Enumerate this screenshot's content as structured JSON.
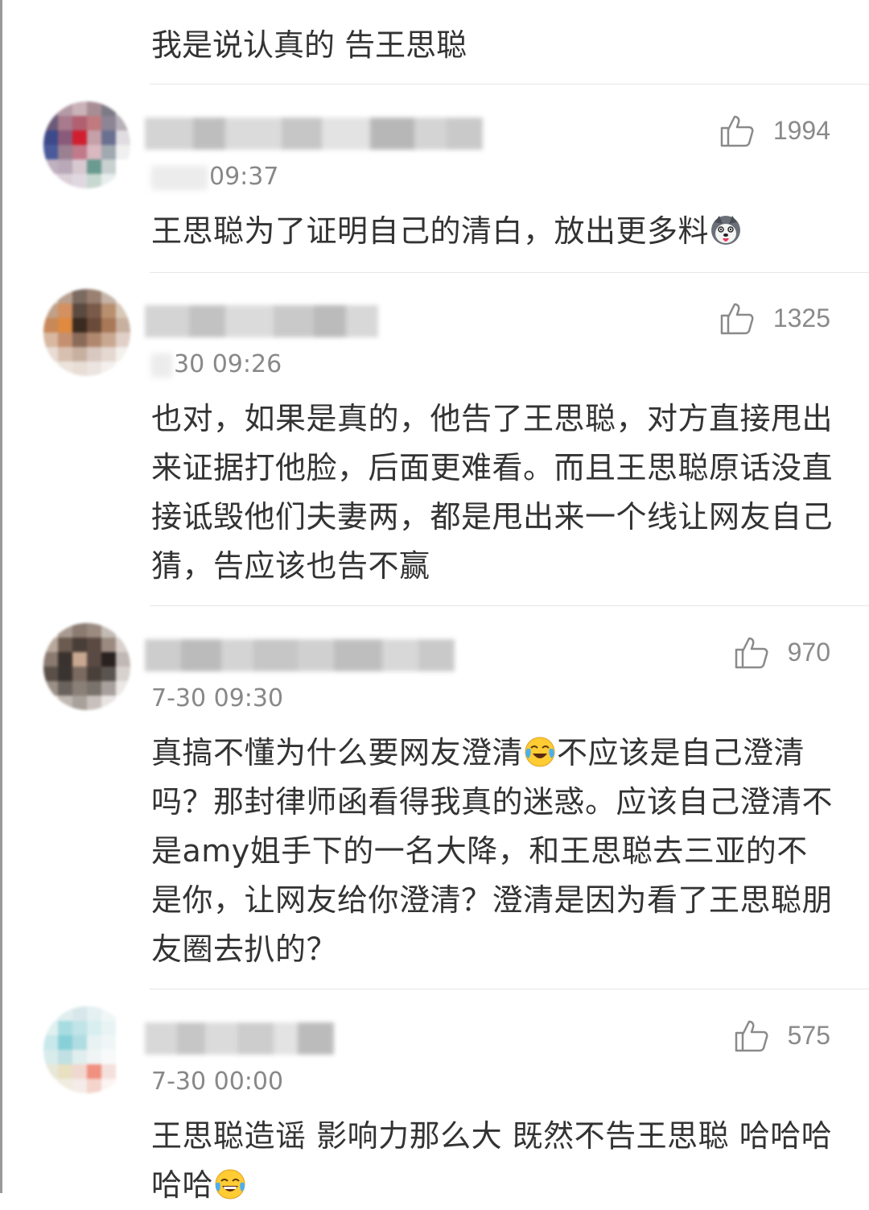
{
  "prev_comment": {
    "text": "我是说认真的 告王思聪"
  },
  "comments": [
    {
      "time": "09:37",
      "likes": "1994",
      "text_before_emoji": "王思聪为了证明自己的清白，放出更多料",
      "text_after_emoji": "",
      "emoji": "husky-emoji"
    },
    {
      "time": "30 09:26",
      "likes": "1325",
      "text_before_emoji": "也对，如果是真的，他告了王思聪，对方直接甩出来证据打他脸，后面更难看。而且王思聪原话没直接诋毁他们夫妻两，都是甩出来一个线让网友自己猜，告应该也告不赢",
      "text_after_emoji": "",
      "emoji": ""
    },
    {
      "time": "7-30 09:30",
      "likes": "970",
      "text_before_emoji": "真搞不懂为什么要网友澄清",
      "text_after_emoji": "不应该是自己澄清吗？那封律师函看得我真的迷惑。应该自己澄清不是amy姐手下的一名大降，和王思聪去三亚的不是你，让网友给你澄清？澄清是因为看了王思聪朋友圈去扒的？",
      "emoji": "crying-laugh-emoji"
    },
    {
      "time": "7-30 00:00",
      "likes": "575",
      "text_before_emoji": "王思聪造谣 影响力那么大 既然不告王思聪 哈哈哈哈哈",
      "text_after_emoji": "",
      "emoji": "laughing-tears-emoji"
    }
  ]
}
